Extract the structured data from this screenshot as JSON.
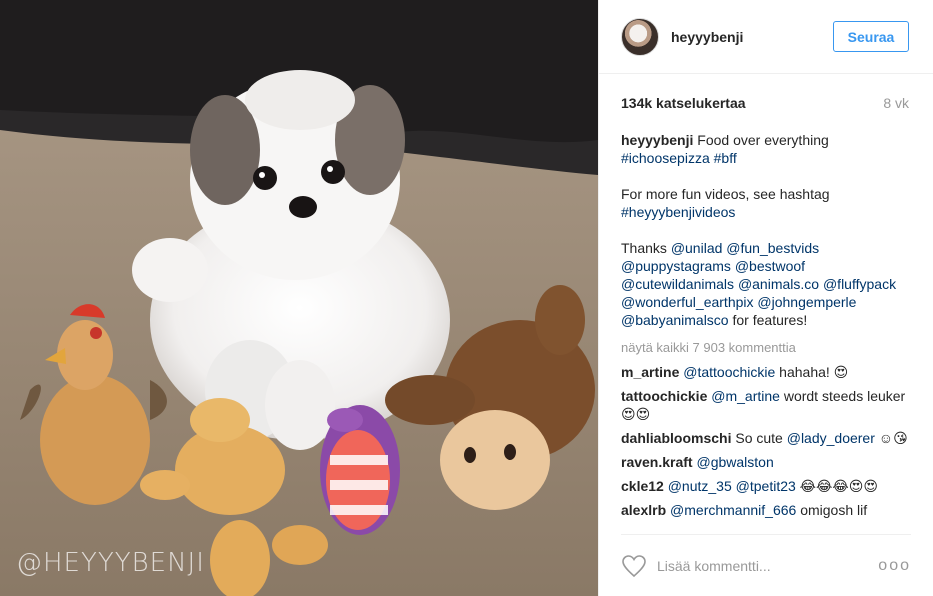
{
  "media": {
    "watermark": "@HEYYYBENJI"
  },
  "header": {
    "username": "heyyybenji",
    "follow_label": "Seuraa"
  },
  "meta": {
    "views": "134k katselukertaa",
    "age": "8 vk"
  },
  "caption": {
    "username": "heyyybenji",
    "line1_text": " Food over everything",
    "line1_tags": [
      "#ichoosepizza",
      "#bff"
    ],
    "para2_text": "For more fun videos, see hashtag",
    "para2_tag": "#heyyybenjivideos",
    "thanks_prefix": "Thanks ",
    "mentions": [
      "@unilad",
      "@fun_bestvids",
      "@puppystagrams",
      "@bestwoof",
      "@cutewildanimals",
      "@animals.co",
      "@fluffypack",
      "@wonderful_earthpix",
      "@johngemperle",
      "@babyanimalsco"
    ],
    "thanks_suffix": " for features!"
  },
  "load_more": "näytä kaikki 7 903 kommenttia",
  "comments": [
    {
      "user": "m_artine",
      "mention": "@tattoochickie",
      "text": " hahaha! 😍"
    },
    {
      "user": "tattoochickie",
      "mention": "@m_artine",
      "text": " wordt steeds leuker 😍😍"
    },
    {
      "user": "dahliabloomschi",
      "mention": "",
      "text": "So cute ",
      "mention2": "@lady_doerer",
      "text2": " ☺😘"
    },
    {
      "user": "raven.kraft",
      "mention": "@gbwalston",
      "text": ""
    },
    {
      "user": "ckle12",
      "mention": "@nutz_35 @tpetit23",
      "text": " 😂😂😂😍😍"
    },
    {
      "user": "alexlrb",
      "mention": "@merchmannif_666",
      "text": " omigosh lif"
    }
  ],
  "footer": {
    "add_comment_placeholder": "Lisää kommentti...",
    "more_label": "ooo"
  },
  "colors": {
    "link": "#003569",
    "accent": "#3897f0",
    "muted": "#999999"
  }
}
